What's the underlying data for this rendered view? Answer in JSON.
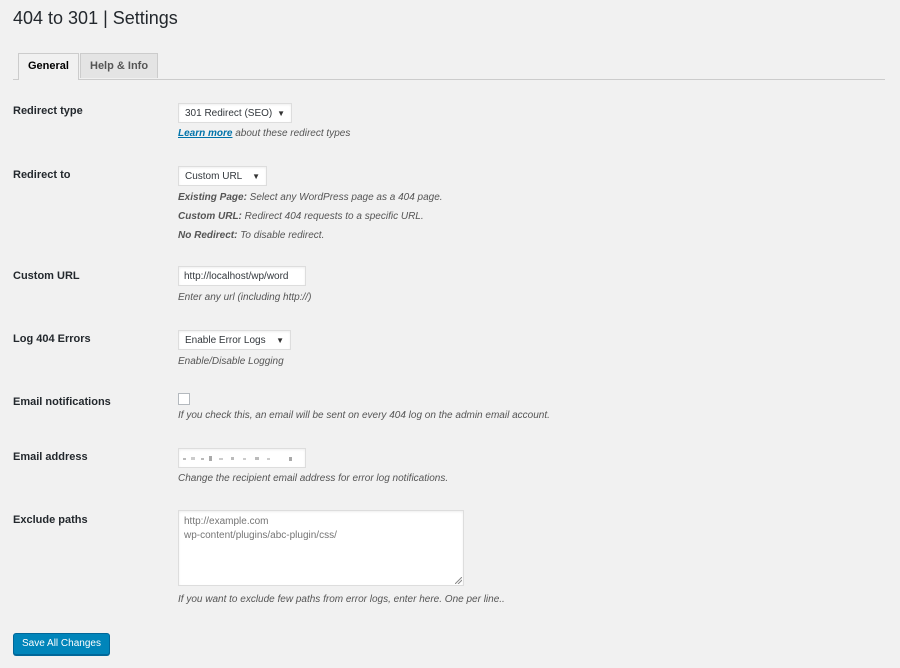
{
  "page": {
    "title": "404 to 301 | Settings"
  },
  "tabs": [
    {
      "label": "General",
      "active": true
    },
    {
      "label": "Help & Info",
      "active": false
    }
  ],
  "fields": {
    "redirect_type": {
      "label": "Redirect type",
      "value": "301 Redirect (SEO)",
      "desc_link": "Learn more",
      "desc_text": " about these redirect types"
    },
    "redirect_to": {
      "label": "Redirect to",
      "value": "Custom URL",
      "desc": [
        {
          "term": "Existing Page:",
          "text": " Select any WordPress page as a 404 page."
        },
        {
          "term": "Custom URL:",
          "text": " Redirect 404 requests to a specific URL."
        },
        {
          "term": "No Redirect:",
          "text": " To disable redirect."
        }
      ]
    },
    "custom_url": {
      "label": "Custom URL",
      "value": "http://localhost/wp/word",
      "desc": "Enter any url (including http://)"
    },
    "log_errors": {
      "label": "Log 404 Errors",
      "value": "Enable Error Logs",
      "desc": "Enable/Disable Logging"
    },
    "email_notifications": {
      "label": "Email notifications",
      "checked": false,
      "desc": "If you check this, an email will be sent on every 404 log on the admin email account."
    },
    "email_address": {
      "label": "Email address",
      "value": "",
      "desc": "Change the recipient email address for error log notifications."
    },
    "exclude_paths": {
      "label": "Exclude paths",
      "placeholder": "http://example.com\nwp-content/plugins/abc-plugin/css/",
      "desc": "If you want to exclude few paths from error logs, enter here. One per line.."
    }
  },
  "save_button": {
    "label": "Save All Changes"
  },
  "colors": {
    "accent": "#0085ba",
    "link": "#0073aa",
    "background": "#f1f1f1"
  },
  "icons": {
    "select_arrow": "select-arrow-icon",
    "resize_grip": "resize-grip-icon"
  }
}
